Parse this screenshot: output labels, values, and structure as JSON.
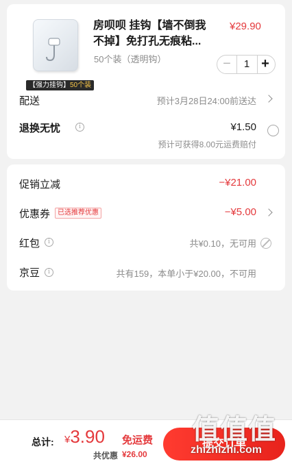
{
  "colors": {
    "accent": "#e4393c",
    "muted": "#8c8c8c",
    "badge_highlight": "#f7c64a"
  },
  "product": {
    "image_icon": "wall-hook-product-image",
    "badge_prefix": "【强力挂钩】",
    "badge_highlight": "50个装",
    "title": "房呗呗 挂钩【墙不倒我不掉】免打孔无痕粘...",
    "price": "¥29.90",
    "spec": "50个装（透明钩）",
    "quantity": "1",
    "minus_symbol": "−",
    "plus_symbol": "+"
  },
  "delivery": {
    "label": "配送",
    "value": "预计3月28日24:00前送达"
  },
  "return_service": {
    "label": "退换无忧",
    "price": "¥1.50",
    "note": "预计可获得8.00元运费赔付"
  },
  "discounts": {
    "promo": {
      "label": "促销立减",
      "value": "−¥21.00"
    },
    "coupon": {
      "label": "优惠券",
      "tag": "已选推荐优惠",
      "value": "−¥5.00"
    },
    "red_packet": {
      "label": "红包",
      "value": "共¥0.10，无可用"
    },
    "jd_beans": {
      "label": "京豆",
      "value": "共有159，本单小于¥20.00，不可用"
    }
  },
  "footer": {
    "total_label": "总计:",
    "currency": "¥",
    "total_amount": "3.90",
    "free_shipping": "免运费",
    "saved_label": "共优惠",
    "saved_amount": "¥26.00",
    "submit_label": "提交订单"
  },
  "watermark": {
    "icons": "值值值",
    "text": "zhizhizhi.com"
  }
}
